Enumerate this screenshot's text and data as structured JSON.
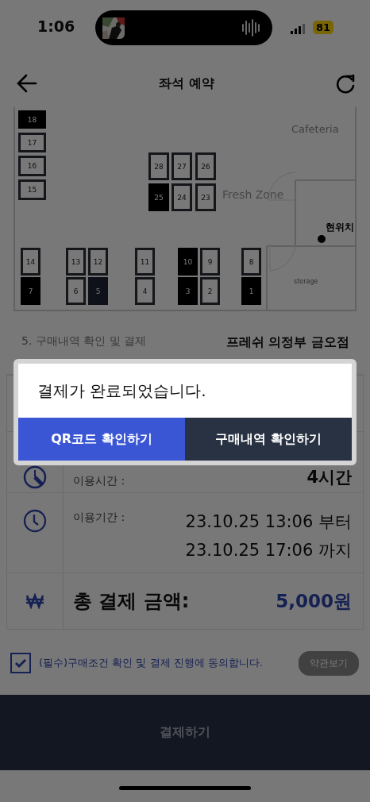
{
  "status_bar": {
    "time": "1:06",
    "battery": "81"
  },
  "header": {
    "title": "좌석 예약"
  },
  "seat_map": {
    "labels": [
      {
        "kind": "zone",
        "text": "Cafeteria"
      },
      {
        "kind": "zone",
        "text": "Fresh Zone"
      },
      {
        "kind": "location",
        "text": "현위치"
      },
      {
        "kind": "room",
        "text": "storage"
      }
    ],
    "seats": [
      {
        "number": "18",
        "occupied": true,
        "selected": false
      },
      {
        "number": "17",
        "occupied": false,
        "selected": false
      },
      {
        "number": "16",
        "occupied": false,
        "selected": false
      },
      {
        "number": "15",
        "occupied": false,
        "selected": false
      },
      {
        "number": "28",
        "occupied": false,
        "selected": false
      },
      {
        "number": "27",
        "occupied": false,
        "selected": false
      },
      {
        "number": "26",
        "occupied": false,
        "selected": false
      },
      {
        "number": "25",
        "occupied": true,
        "selected": false
      },
      {
        "number": "24",
        "occupied": false,
        "selected": false
      },
      {
        "number": "23",
        "occupied": false,
        "selected": false
      },
      {
        "number": "14",
        "occupied": false,
        "selected": false
      },
      {
        "number": "13",
        "occupied": false,
        "selected": false
      },
      {
        "number": "12",
        "occupied": false,
        "selected": false
      },
      {
        "number": "11",
        "occupied": false,
        "selected": false
      },
      {
        "number": "10",
        "occupied": true,
        "selected": false
      },
      {
        "number": "9",
        "occupied": false,
        "selected": false
      },
      {
        "number": "8",
        "occupied": false,
        "selected": false
      },
      {
        "number": "7",
        "occupied": true,
        "selected": false
      },
      {
        "number": "6",
        "occupied": false,
        "selected": false
      },
      {
        "number": "5",
        "occupied": false,
        "selected": true
      },
      {
        "number": "4",
        "occupied": false,
        "selected": false
      },
      {
        "number": "3",
        "occupied": true,
        "selected": false
      },
      {
        "number": "2",
        "occupied": false,
        "selected": false
      },
      {
        "number": "1",
        "occupied": true,
        "selected": false
      }
    ]
  },
  "section": {
    "title": "5. 구매내역 확인 및 결제",
    "store": "프레쉬 의정부 금오점"
  },
  "details": [
    {
      "kind": "blank"
    },
    {
      "kind": "time",
      "label": "이용시간 :",
      "value": "4시간"
    },
    {
      "kind": "period",
      "label": "이용기간 :",
      "lines": [
        "23.10.25 13:06 부터",
        "23.10.25 17:06 까지"
      ]
    },
    {
      "kind": "total",
      "label": "총 결제 금액:",
      "value": "5,000원"
    }
  ],
  "agreement": {
    "checked": true,
    "text": "(필수)구매조건 확인 및 결제 진행에 동의합니다.",
    "button": "약관보기"
  },
  "pay_button": "결제하기",
  "dialog": {
    "message": "결제가 완료되었습니다.",
    "buttons": [
      {
        "label": "QR코드 확인하기",
        "kind": "primary"
      },
      {
        "label": "구매내역 확인하기",
        "kind": "secondary"
      }
    ]
  }
}
